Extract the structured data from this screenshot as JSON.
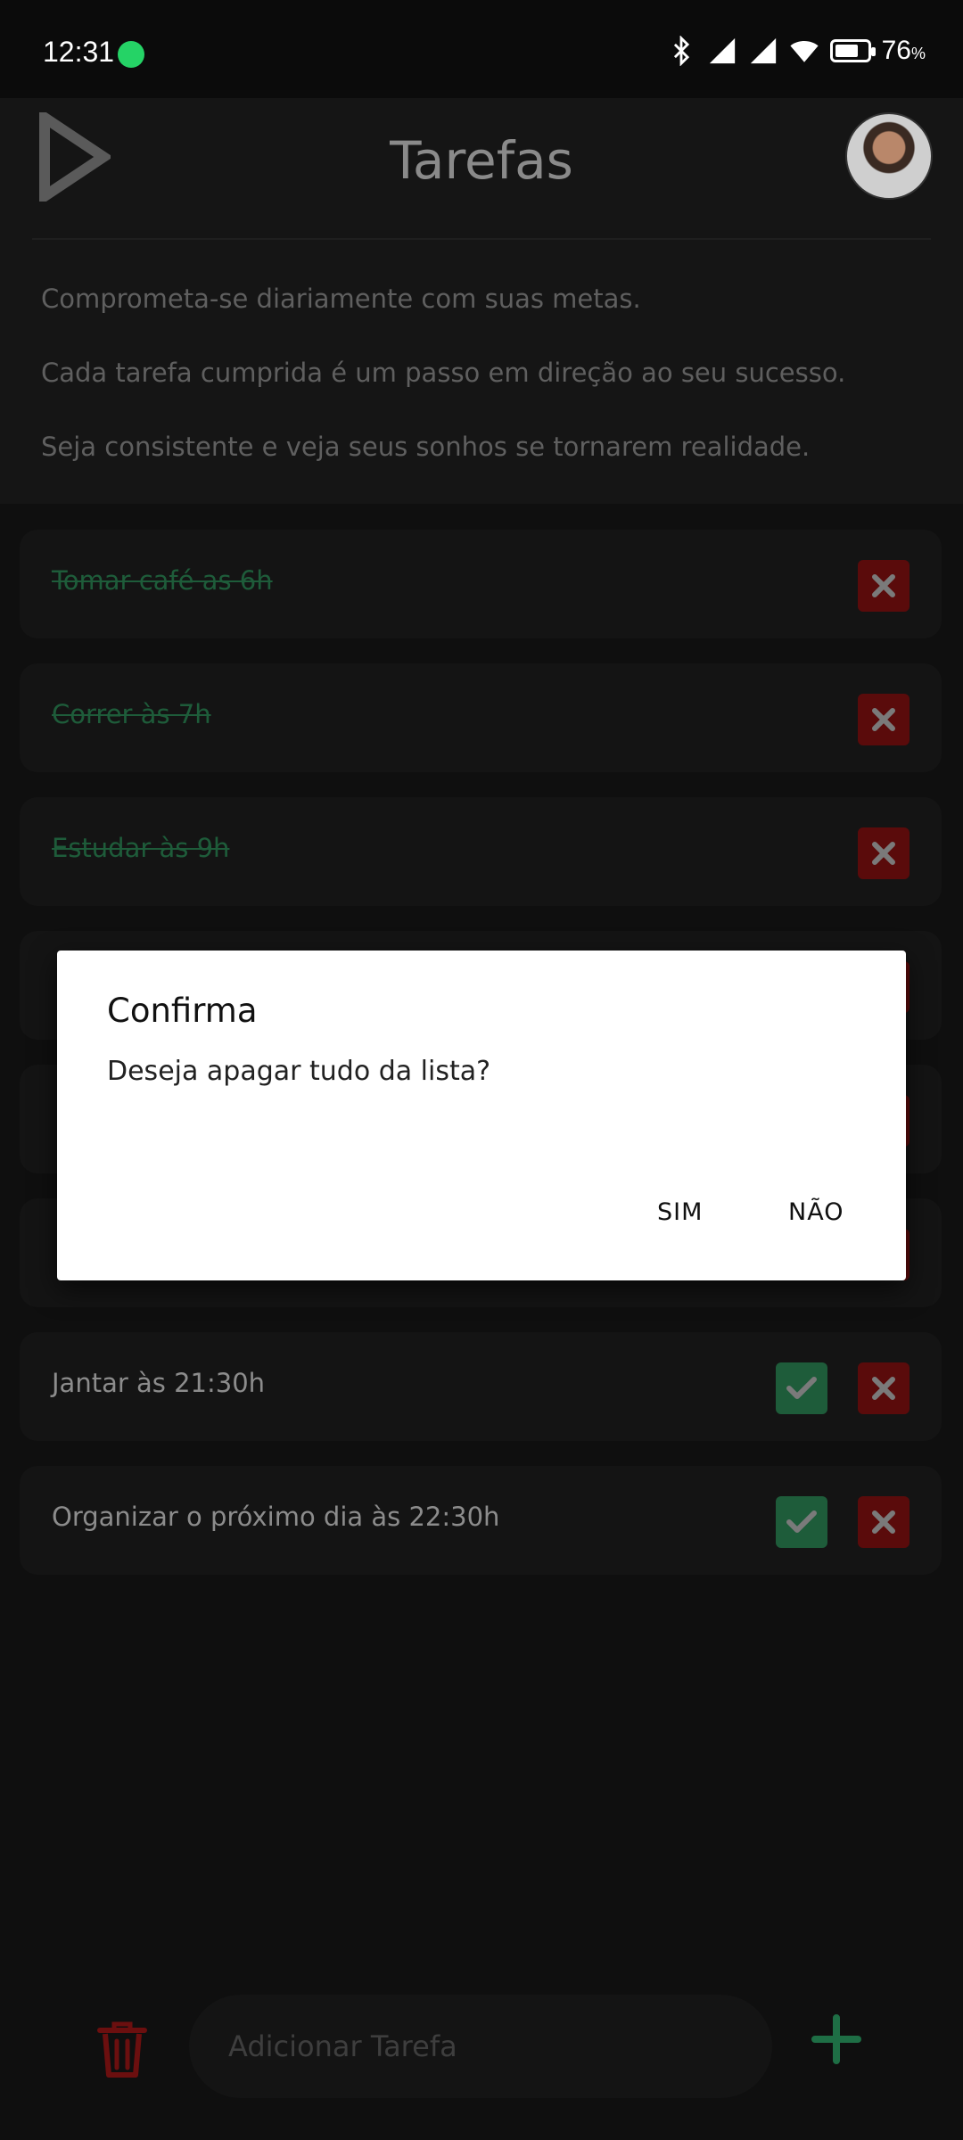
{
  "status_bar": {
    "time": "12:31",
    "battery": "76",
    "battery_unit": "%",
    "battery_level": 0.76
  },
  "header": {
    "title": "Tarefas",
    "motto": [
      "Comprometa-se diariamente com suas metas.",
      "Cada tarefa cumprida é um passo em direção ao seu sucesso.",
      "Seja consistente e veja seus sonhos se tornarem realidade."
    ]
  },
  "tasks": [
    {
      "label": "Tomar café as 6h",
      "done": true
    },
    {
      "label": "Correr às 7h",
      "done": true
    },
    {
      "label": "Estudar às 9h",
      "done": true
    },
    {
      "label": "Jantar às 21:30h",
      "done": false
    },
    {
      "label": "Organizar o próximo dia às 22:30h",
      "done": false
    }
  ],
  "dialog": {
    "title": "Confirma",
    "message": "Deseja apagar tudo da lista?",
    "yes_label": "SIM",
    "no_label": "NÃO"
  },
  "bottom": {
    "input_placeholder": "Adicionar Tarefa"
  },
  "colors": {
    "background": "#0f0f0f",
    "done_green": "#1e5c3a",
    "delete_red": "#5a0b0b",
    "trash_red": "#6b0f0f",
    "plus_green": "#1e6e45"
  },
  "icons": [
    "whatsapp-icon",
    "bluetooth-icon",
    "signal-icon",
    "wifi-icon",
    "battery-icon",
    "play-logo-icon",
    "close-icon",
    "check-icon",
    "trash-icon",
    "plus-icon"
  ]
}
